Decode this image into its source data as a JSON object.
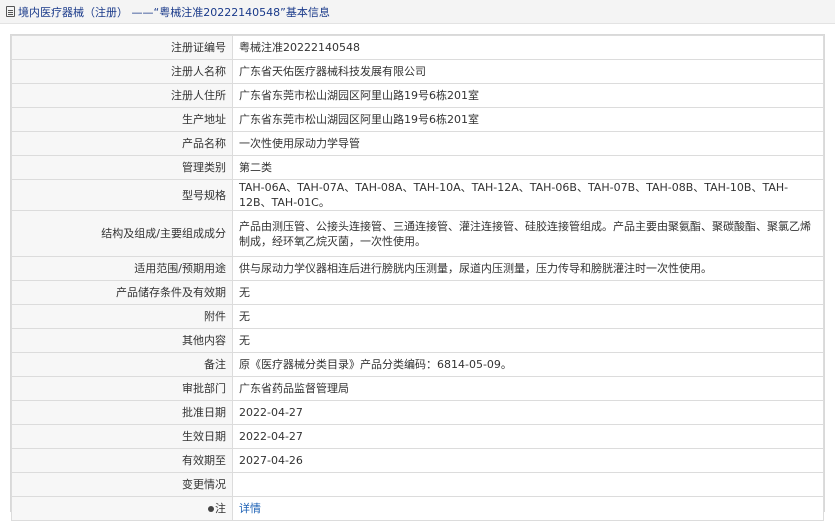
{
  "header": {
    "title": "境内医疗器械（注册） ——“粤械注准20222140548”基本信息"
  },
  "rows": [
    {
      "label": "注册证编号",
      "value": "粤械注准20222140548"
    },
    {
      "label": "注册人名称",
      "value": "广东省天佑医疗器械科技发展有限公司"
    },
    {
      "label": "注册人住所",
      "value": "广东省东莞市松山湖园区阿里山路19号6栋201室"
    },
    {
      "label": "生产地址",
      "value": "广东省东莞市松山湖园区阿里山路19号6栋201室"
    },
    {
      "label": "产品名称",
      "value": "一次性使用尿动力学导管"
    },
    {
      "label": "管理类别",
      "value": "第二类"
    },
    {
      "label": "型号规格",
      "value": "TAH-06A、TAH-07A、TAH-08A、TAH-10A、TAH-12A、TAH-06B、TAH-07B、TAH-08B、TAH-10B、TAH-12B、TAH-01C。"
    },
    {
      "label": "结构及组成/主要组成成分",
      "value": "产品由测压管、公接头连接管、三通连接管、灌注连接管、硅胶连接管组成。产品主要由聚氨酯、聚碳酸酯、聚氯乙烯制成，经环氧乙烷灭菌，一次性使用。"
    },
    {
      "label": "适用范围/预期用途",
      "value": "供与尿动力学仪器相连后进行膀胱内压测量，尿道内压测量，压力传导和膀胱灌注时一次性使用。"
    },
    {
      "label": "产品储存条件及有效期",
      "value": "无"
    },
    {
      "label": "附件",
      "value": "无"
    },
    {
      "label": "其他内容",
      "value": "无"
    },
    {
      "label": "备注",
      "value": "原《医疗器械分类目录》产品分类编码：6814-05-09。"
    },
    {
      "label": "审批部门",
      "value": "广东省药品监督管理局"
    },
    {
      "label": "批准日期",
      "value": "2022-04-27"
    },
    {
      "label": "生效日期",
      "value": "2022-04-27"
    },
    {
      "label": "有效期至",
      "value": "2027-04-26"
    },
    {
      "label": "变更情况",
      "value": ""
    }
  ],
  "note_row": {
    "label": "注",
    "link": "详情"
  }
}
